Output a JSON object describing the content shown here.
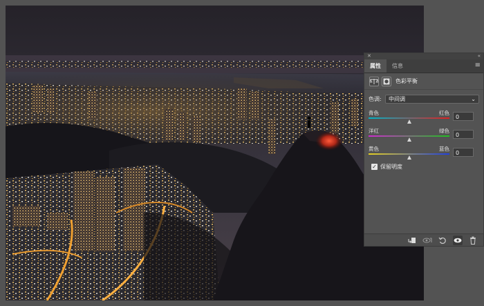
{
  "panel": {
    "tabs": [
      {
        "label": "属性",
        "active": true
      },
      {
        "label": "信息",
        "active": false
      }
    ],
    "adjustment_title": "色彩平衡",
    "tone": {
      "label": "色调:",
      "value": "中间调"
    },
    "sliders": [
      {
        "left_label": "青色",
        "right_label": "红色",
        "value": "0",
        "gradient": [
          "#00b4c8",
          "#e02020"
        ]
      },
      {
        "left_label": "洋红",
        "right_label": "绿色",
        "value": "0",
        "gradient": [
          "#d02ad0",
          "#20c020"
        ]
      },
      {
        "left_label": "黄色",
        "right_label": "蓝色",
        "value": "0",
        "gradient": [
          "#e6d020",
          "#2040e0"
        ]
      }
    ],
    "preserve_luminosity": {
      "label": "保留明度",
      "checked": true
    }
  },
  "icons": {
    "close": "close-icon",
    "collapse": "collapse-icon",
    "menu": "panel-menu-icon",
    "balance": "balance-scale-icon",
    "mask": "mask-icon",
    "clip": "clip-to-layer-icon",
    "view_previous": "view-previous-state-icon",
    "reset": "reset-icon",
    "visibility": "eye-icon",
    "delete": "trash-icon"
  }
}
